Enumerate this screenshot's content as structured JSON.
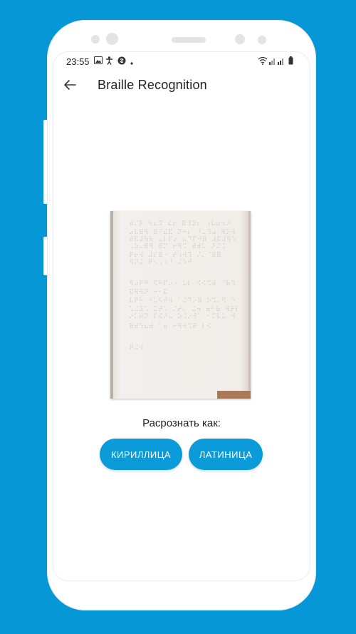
{
  "statusbar": {
    "time": "23:55",
    "left_icons": [
      "image-icon",
      "accessibility-icon",
      "shazam-icon",
      "dot-icon"
    ],
    "right_icons": [
      "wifi-icon",
      "signal-icon",
      "signal-icon",
      "battery-icon"
    ]
  },
  "appbar": {
    "back_icon": "arrow-left-icon",
    "title": "Braille Recognition"
  },
  "main": {
    "image_alt": "braille-page-photo",
    "prompt": "Расрознать как:",
    "buttons": {
      "cyrillic": "КИРИЛЛИЦА",
      "latin": "ЛАТИНИЦА"
    }
  },
  "colors": {
    "background": "#0597d6",
    "accent": "#0a9bd8",
    "paper": "#f2eeeb"
  }
}
